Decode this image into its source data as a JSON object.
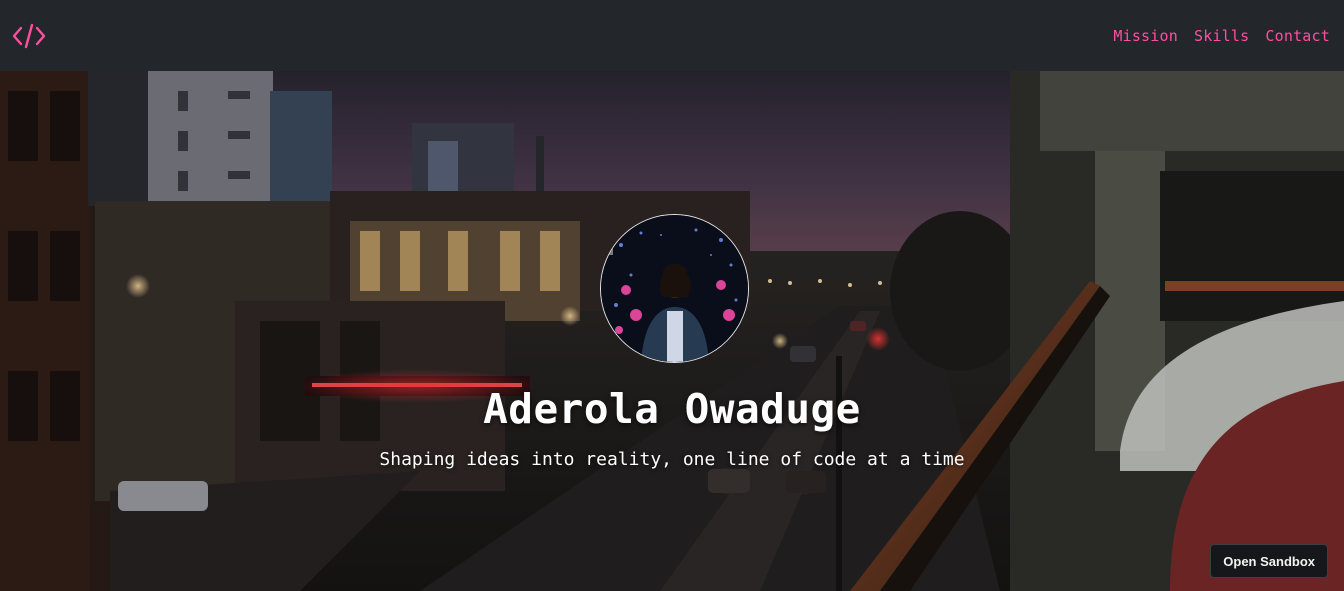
{
  "header": {
    "logo_icon": "code-brackets-icon",
    "accent_color": "#ff4fa0",
    "nav": [
      {
        "label": "Mission"
      },
      {
        "label": "Skills"
      },
      {
        "label": "Contact"
      }
    ]
  },
  "hero": {
    "name": "Aderola Owaduge",
    "tagline": "Shaping ideas into reality, one line of code at a time",
    "background": "night-city-street-photo",
    "avatar": "profile-photo"
  },
  "sandbox": {
    "label": "Open Sandbox"
  }
}
